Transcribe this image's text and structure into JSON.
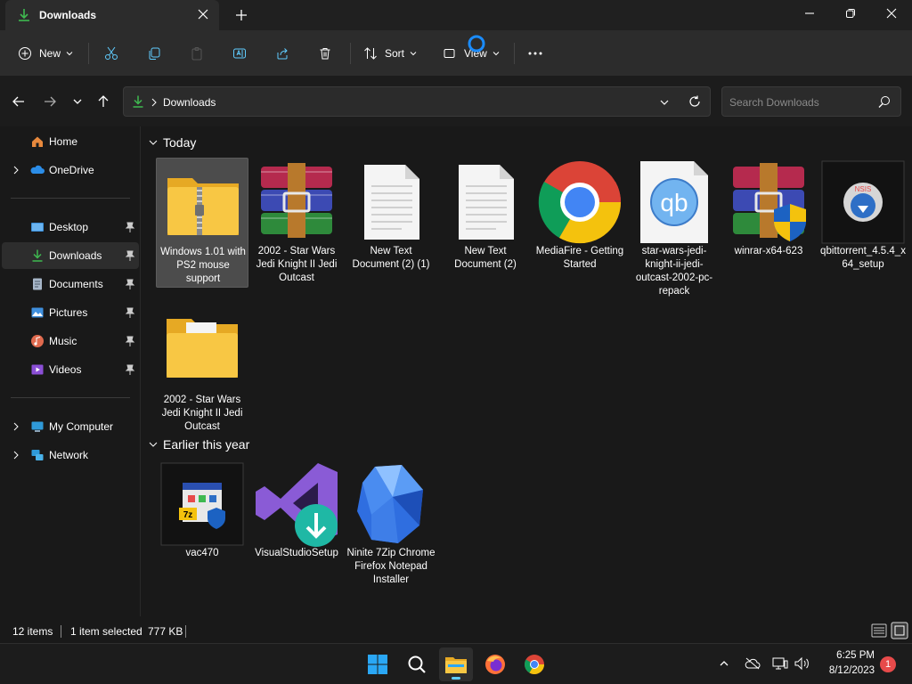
{
  "window": {
    "tab_title": "Downloads"
  },
  "toolbar": {
    "new_label": "New",
    "sort_label": "Sort",
    "view_label": "View"
  },
  "address": {
    "breadcrumb": "Downloads"
  },
  "search": {
    "placeholder": "Search Downloads"
  },
  "sidebar": {
    "items": [
      {
        "label": "Home",
        "icon": "home-icon"
      },
      {
        "label": "OneDrive",
        "icon": "onedrive-icon"
      },
      {
        "label": "Desktop",
        "icon": "desktop-icon"
      },
      {
        "label": "Downloads",
        "icon": "downloads-icon"
      },
      {
        "label": "Documents",
        "icon": "documents-icon"
      },
      {
        "label": "Pictures",
        "icon": "pictures-icon"
      },
      {
        "label": "Music",
        "icon": "music-icon"
      },
      {
        "label": "Videos",
        "icon": "videos-icon"
      },
      {
        "label": "My Computer",
        "icon": "computer-icon"
      },
      {
        "label": "Network",
        "icon": "network-icon"
      }
    ]
  },
  "groups": {
    "today": "Today",
    "earlier": "Earlier this year"
  },
  "files": [
    {
      "name": "Windows 1.01 with PS2 mouse support",
      "icon": "zip-folder-icon"
    },
    {
      "name": "2002 - Star Wars Jedi Knight II Jedi Outcast",
      "icon": "winrar-archive-icon"
    },
    {
      "name": "New Text Document (2) (1)",
      "icon": "text-document-icon"
    },
    {
      "name": "New Text Document (2)",
      "icon": "text-document-icon"
    },
    {
      "name": "MediaFire - Getting Started",
      "icon": "chrome-pdf-icon"
    },
    {
      "name": "star-wars-jedi-knight-ii-jedi-outcast-2002-pc-repack",
      "icon": "qbittorrent-file-icon"
    },
    {
      "name": "winrar-x64-623",
      "icon": "winrar-installer-icon"
    },
    {
      "name": "qbittorrent_4.5.4_x64_setup",
      "icon": "nsis-installer-icon"
    },
    {
      "name": "2002 - Star Wars Jedi Knight II Jedi Outcast",
      "icon": "folder-icon"
    },
    {
      "name": "vac470",
      "icon": "7zip-installer-icon"
    },
    {
      "name": "VisualStudioSetup",
      "icon": "visual-studio-installer-icon"
    },
    {
      "name": "Ninite 7Zip Chrome Firefox Notepad Installer",
      "icon": "ninite-icon"
    }
  ],
  "status": {
    "item_count": "12 items",
    "selection": "1 item selected",
    "size": "777 KB"
  },
  "taskbar": {
    "time": "6:25 PM",
    "date": "8/12/2023",
    "notifications": "1"
  },
  "colors": {
    "accent": "#60cdff",
    "folder_yellow": "#f8c744",
    "selection_bg": "#4c4c4c"
  }
}
